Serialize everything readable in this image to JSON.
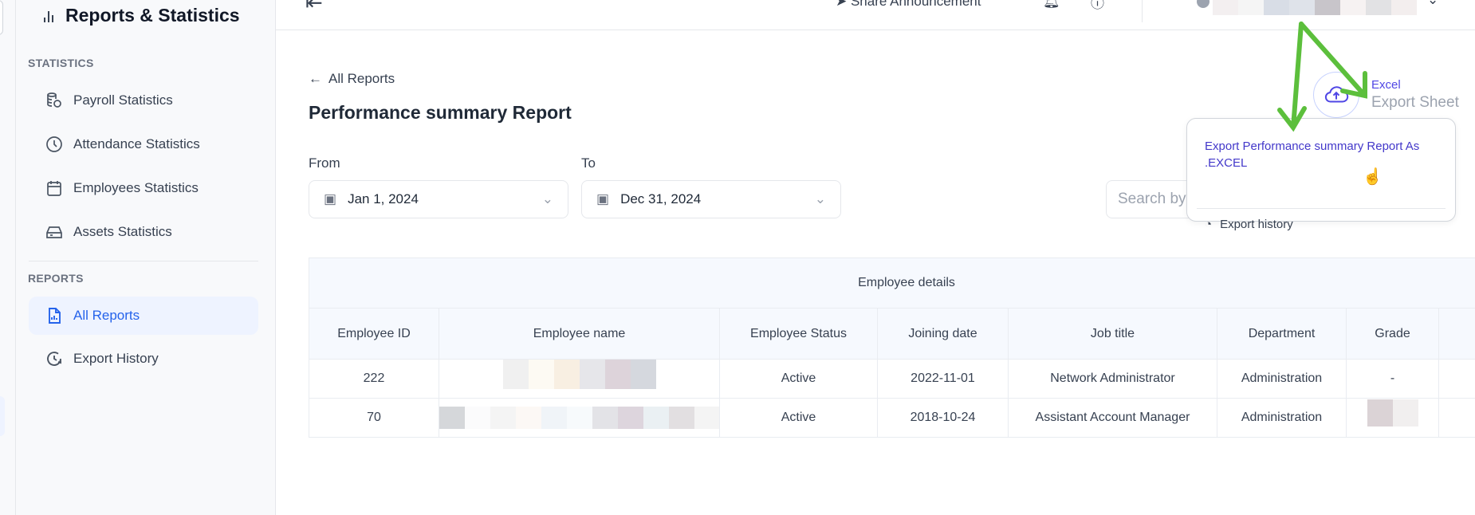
{
  "sidebar": {
    "title": "Reports & Statistics",
    "statistics_label": "STATISTICS",
    "statistics_items": [
      {
        "label": "Payroll Statistics"
      },
      {
        "label": "Attendance Statistics"
      },
      {
        "label": "Employees Statistics"
      },
      {
        "label": "Assets Statistics"
      }
    ],
    "reports_label": "REPORTS",
    "reports_items": [
      {
        "label": "All Reports",
        "active": true
      },
      {
        "label": "Export History"
      }
    ]
  },
  "topbar": {
    "share": "Share Announcement"
  },
  "main": {
    "back": "All Reports",
    "title": "Performance summary Report",
    "from_label": "From",
    "from_value": "Jan 1, 2024",
    "to_label": "To",
    "to_value": "Dec 31, 2024",
    "search_placeholder": "Search by"
  },
  "export": {
    "type": "Excel",
    "label": "Export Sheet",
    "menu": {
      "option1": "Export Performance summary Report As .EXCEL",
      "option2": "Export history"
    }
  },
  "table": {
    "group": "Employee details",
    "headers": [
      "Employee ID",
      "Employee name",
      "Employee Status",
      "Joining date",
      "Job title",
      "Department",
      "Grade"
    ],
    "rows": [
      {
        "id": "222",
        "name": "",
        "status": "Active",
        "joining": "2022-11-01",
        "job": "Network Administrator",
        "dept": "Administration",
        "grade": "-"
      },
      {
        "id": "70",
        "name": "",
        "status": "Active",
        "joining": "2018-10-24",
        "job": "Assistant Account Manager",
        "dept": "Administration",
        "grade": ""
      }
    ]
  },
  "colors": {
    "accent": "#2563eb",
    "annotation_arrow": "#5cbf3c"
  }
}
